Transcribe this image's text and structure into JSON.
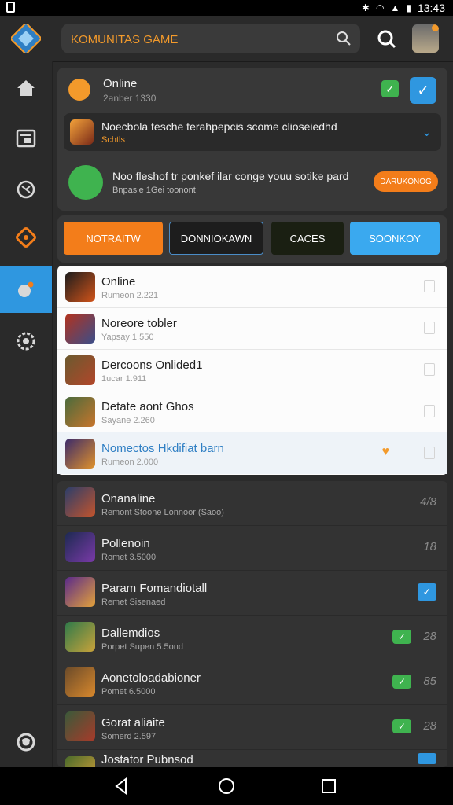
{
  "status_bar": {
    "time": "13:43"
  },
  "search": {
    "placeholder": "KOMUNITAS GAME"
  },
  "notifications": [
    {
      "title": "Online",
      "subtitle": "2anber 1330"
    },
    {
      "title": "Noecbola tesche terahpepcis scome clioseiedhd",
      "subtitle": "Schtls"
    },
    {
      "title": "Noo fleshof tr ponkef ilar conge youu sotike pard",
      "subtitle": "Bnpasie 1Gei toonont",
      "action_label": "DARUKONOG"
    }
  ],
  "tabs": [
    {
      "label": "NOTRAITW"
    },
    {
      "label": "DONNIOKAWN"
    },
    {
      "label": "CACES"
    },
    {
      "label": "SOONKOY"
    }
  ],
  "white_list": [
    {
      "title": "Online",
      "subtitle": "Rumeon 2.221"
    },
    {
      "title": "Noreore tobler",
      "subtitle": "Yapsay 1.550"
    },
    {
      "title": "Dercoons Onlided1",
      "subtitle": "1ucar 1.911"
    },
    {
      "title": "Detate aont Ghos",
      "subtitle": "Sayane 2.260"
    },
    {
      "title": "Nomectos Hkdifiat barn",
      "subtitle": "Rumeon 2.000"
    }
  ],
  "dark_list": [
    {
      "title": "Onanaline",
      "subtitle": "Remont Stoone Lonnoor (Saoo)",
      "count": "4/8"
    },
    {
      "title": "Pollenoin",
      "subtitle": "Romet 3.5000",
      "count": "18"
    },
    {
      "title": "Param Fomandiotall",
      "subtitle": "Remet Sisenaed",
      "count": ""
    },
    {
      "title": "Dallemdios",
      "subtitle": "Porpet Supen 5.5ond",
      "count": "28"
    },
    {
      "title": "Aonetoloadabioner",
      "subtitle": "Pomet 6.5000",
      "count": "85"
    },
    {
      "title": "Gorat aliaite",
      "subtitle": "Somerd 2.597",
      "count": "28"
    },
    {
      "title": "Jostator Pubnsod",
      "subtitle": "",
      "count": ""
    }
  ]
}
